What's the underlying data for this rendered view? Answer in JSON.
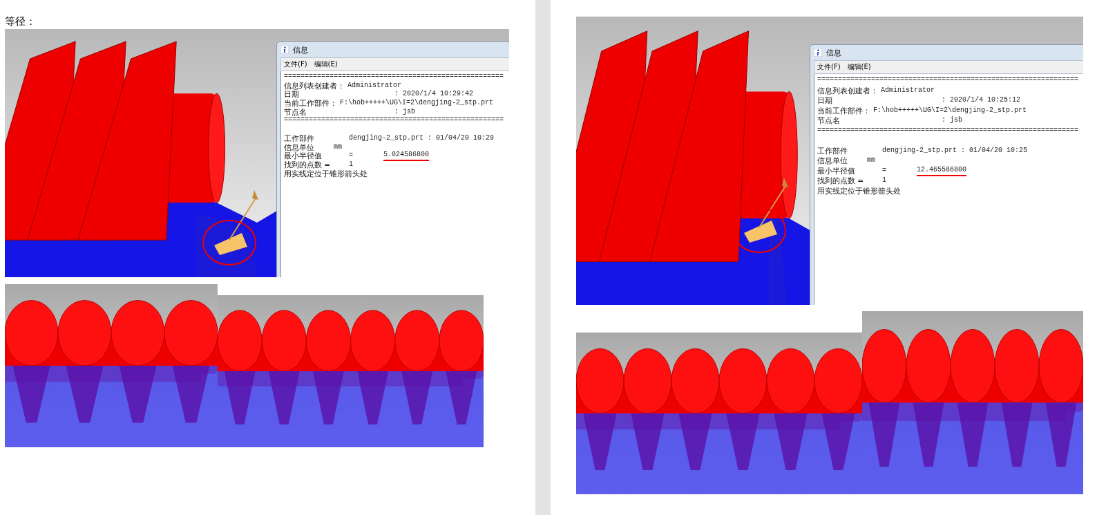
{
  "pages": [
    {
      "heading": "等径：",
      "window": {
        "title": "信息",
        "menu": [
          "文件(F)",
          "编辑(E)"
        ],
        "lines": [
          {
            "kind": "rule",
            "parts": [
              "====================================================="
            ]
          },
          {
            "kind": "pair",
            "parts": [
              "信息列表创建者：",
              "Administrator"
            ]
          },
          {
            "kind": "far",
            "parts": [
              "日期",
              ": 2020/1/4 10:29:42"
            ]
          },
          {
            "kind": "pair",
            "parts": [
              "当前工作部件：",
              "F:\\hob+++++\\UG\\I=2\\dengjing-2_stp.prt"
            ]
          },
          {
            "kind": "far",
            "parts": [
              "节点名",
              ": jsb"
            ]
          },
          {
            "kind": "rule",
            "parts": [
              "====================================================="
            ]
          },
          {
            "kind": "blank"
          },
          {
            "kind": "grid",
            "parts": [
              "工作部件",
              "dengjing-2_stp.prt : 01/04/20 10:29"
            ]
          },
          {
            "kind": "unit",
            "parts": [
              "信息单位",
              "mm"
            ]
          },
          {
            "kind": "equation",
            "parts": [
              "最小半径值",
              "=",
              "5.024586800"
            ],
            "underlined": true
          },
          {
            "kind": "grid",
            "parts": [
              "找到的点数 =",
              "1"
            ]
          },
          {
            "kind": "text",
            "parts": [
              "用实线定位于锥形箭头处"
            ]
          }
        ]
      }
    },
    {
      "window": {
        "title": "信息",
        "menu": [
          "文件(F)",
          "编辑(E)"
        ],
        "lines": [
          {
            "kind": "rule",
            "parts": [
              "==============================================================="
            ]
          },
          {
            "kind": "pair",
            "parts": [
              "信息列表创建者：",
              "Administrator"
            ]
          },
          {
            "kind": "far",
            "parts": [
              "日期",
              ": 2020/1/4 10:25:12"
            ]
          },
          {
            "kind": "pair",
            "parts": [
              "当前工作部件：",
              "F:\\hob+++++\\UG\\I=2\\dengjing-2_stp.prt"
            ]
          },
          {
            "kind": "far",
            "parts": [
              "节点名",
              ": jsb"
            ]
          },
          {
            "kind": "rule",
            "parts": [
              "==============================================================="
            ]
          },
          {
            "kind": "blank"
          },
          {
            "kind": "grid",
            "parts": [
              "工作部件",
              "dengjing-2_stp.prt : 01/04/20 10:25"
            ]
          },
          {
            "kind": "unit",
            "parts": [
              "信息单位",
              "mm"
            ]
          },
          {
            "kind": "equation",
            "parts": [
              "最小半径值",
              "=",
              "12.465586800"
            ],
            "underlined": true
          },
          {
            "kind": "grid",
            "parts": [
              "找到的点数 =",
              "1"
            ]
          },
          {
            "kind": "text",
            "parts": [
              "用实线定位于锥形箭头处"
            ]
          }
        ]
      }
    }
  ]
}
